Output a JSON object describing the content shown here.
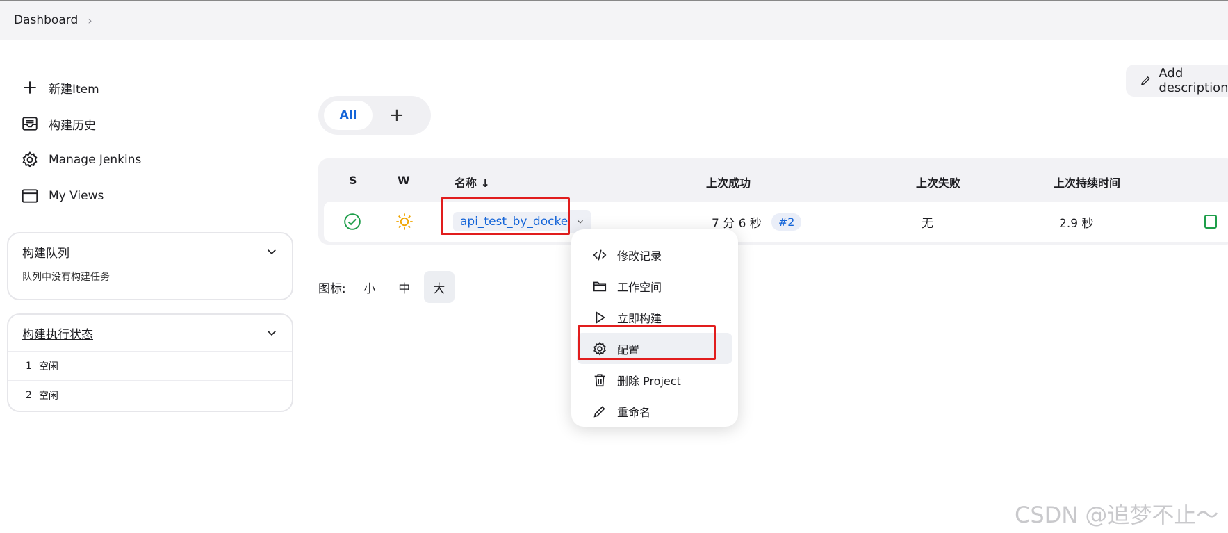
{
  "breadcrumb": {
    "home": "Dashboard",
    "separator": "›"
  },
  "sidebar": {
    "items": [
      {
        "label": "新建Item",
        "icon": "plus-icon"
      },
      {
        "label": "构建历史",
        "icon": "inbox-icon"
      },
      {
        "label": "Manage Jenkins",
        "icon": "gear-icon"
      },
      {
        "label": "My Views",
        "icon": "window-icon"
      }
    ]
  },
  "build_queue": {
    "title": "构建队列",
    "empty_text": "队列中没有构建任务"
  },
  "executors": {
    "title": "构建执行状态",
    "rows": [
      {
        "num": "1",
        "status": "空闲"
      },
      {
        "num": "2",
        "status": "空闲"
      }
    ]
  },
  "header": {
    "add_description": "Add description"
  },
  "tabs": {
    "all": "All",
    "add": "+"
  },
  "table": {
    "headers": {
      "s": "S",
      "w": "W",
      "name": "名称 ↓",
      "last_success": "上次成功",
      "last_failure": "上次失败",
      "last_duration": "上次持续时间"
    },
    "rows": [
      {
        "name": "api_test_by_docker",
        "last_success": "7 分 6 秒",
        "build": "#2",
        "last_failure": "无",
        "last_duration": "2.9 秒"
      }
    ]
  },
  "icon_size": {
    "label": "图标:",
    "small": "小",
    "medium": "中",
    "large": "大"
  },
  "context_menu": {
    "items": [
      {
        "label": "修改记录",
        "icon": "code-icon"
      },
      {
        "label": "工作空间",
        "icon": "folder-icon"
      },
      {
        "label": "立即构建",
        "icon": "play-icon"
      },
      {
        "label": "配置",
        "icon": "gear-icon"
      },
      {
        "label": "删除 Project",
        "icon": "trash-icon"
      },
      {
        "label": "重命名",
        "icon": "pencil-icon"
      }
    ]
  },
  "watermark": "CSDN @追梦不止～",
  "colors": {
    "accent": "#1565d8",
    "highlight": "#e11d1d",
    "success": "#1e9e4a",
    "sunny": "#f0a500"
  }
}
